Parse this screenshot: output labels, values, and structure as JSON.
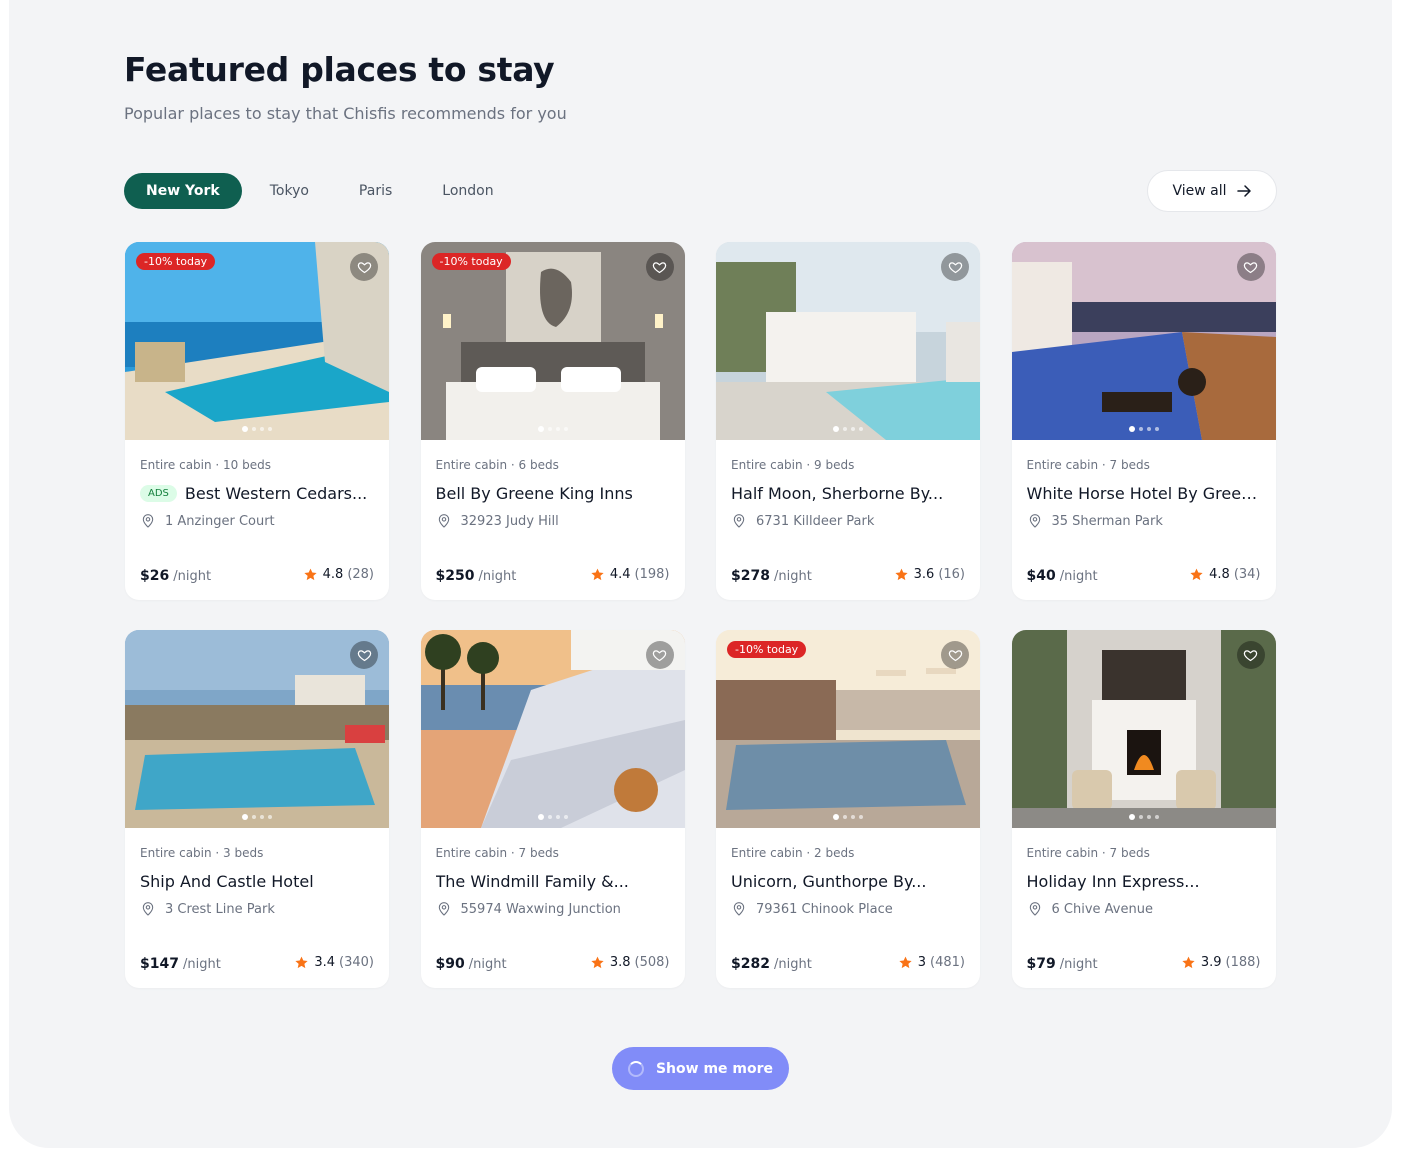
{
  "header": {
    "title": "Featured places to stay",
    "subtitle": "Popular places to stay that Chisfis recommends for you"
  },
  "tabs": [
    {
      "label": "New York",
      "active": true
    },
    {
      "label": "Tokyo",
      "active": false
    },
    {
      "label": "Paris",
      "active": false
    },
    {
      "label": "London",
      "active": false
    }
  ],
  "view_all": {
    "label": "View all"
  },
  "colors": {
    "accent": "#0f5f50",
    "badge": "#dc2626",
    "star": "#f97316",
    "more_button": "#818cf8"
  },
  "listings": [
    {
      "meta": "Entire cabin · 10 beds",
      "ads": "ADS",
      "title": "Best Western Cedars...",
      "address": "1 Anzinger Court",
      "price": "$26",
      "unit": "/night",
      "rating": "4.8",
      "reviews": "(28)",
      "badge": "-10% today"
    },
    {
      "meta": "Entire cabin · 6 beds",
      "title": "Bell By Greene King Inns",
      "address": "32923 Judy Hill",
      "price": "$250",
      "unit": "/night",
      "rating": "4.4",
      "reviews": "(198)",
      "badge": "-10% today"
    },
    {
      "meta": "Entire cabin · 9 beds",
      "title": "Half Moon, Sherborne By...",
      "address": "6731 Killdeer Park",
      "price": "$278",
      "unit": "/night",
      "rating": "3.6",
      "reviews": "(16)"
    },
    {
      "meta": "Entire cabin · 7 beds",
      "title": "White Horse Hotel By Green...",
      "address": "35 Sherman Park",
      "price": "$40",
      "unit": "/night",
      "rating": "4.8",
      "reviews": "(34)"
    },
    {
      "meta": "Entire cabin · 3 beds",
      "title": "Ship And Castle Hotel",
      "address": "3 Crest Line Park",
      "price": "$147",
      "unit": "/night",
      "rating": "3.4",
      "reviews": "(340)"
    },
    {
      "meta": "Entire cabin · 7 beds",
      "title": "The Windmill Family &...",
      "address": "55974 Waxwing Junction",
      "price": "$90",
      "unit": "/night",
      "rating": "3.8",
      "reviews": "(508)"
    },
    {
      "meta": "Entire cabin · 2 beds",
      "title": "Unicorn, Gunthorpe By...",
      "address": "79361 Chinook Place",
      "price": "$282",
      "unit": "/night",
      "rating": "3",
      "reviews": "(481)",
      "badge": "-10% today"
    },
    {
      "meta": "Entire cabin · 7 beds",
      "title": "Holiday Inn Express...",
      "address": "6 Chive Avenue",
      "price": "$79",
      "unit": "/night",
      "rating": "3.9",
      "reviews": "(188)"
    }
  ],
  "show_more": {
    "label": "Show me more"
  }
}
